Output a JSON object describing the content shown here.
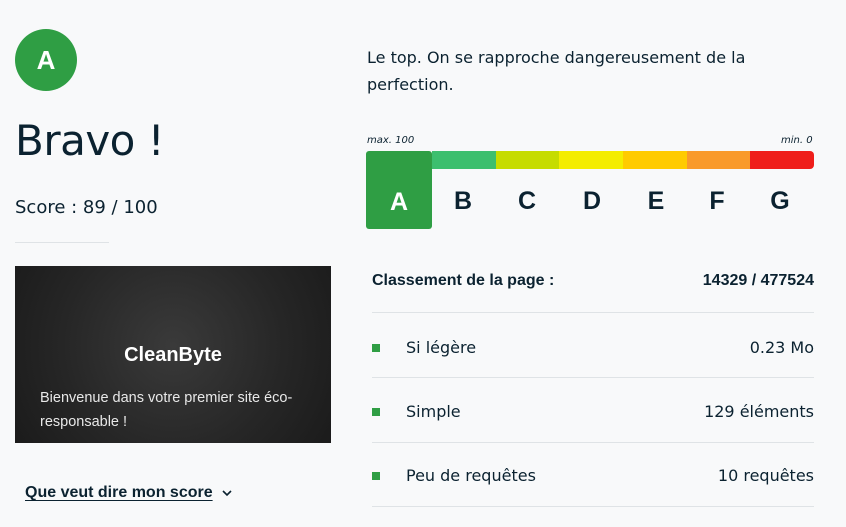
{
  "grade": {
    "letter": "A",
    "color": "#2f9e44"
  },
  "title": "Bravo !",
  "score_text": "Score : 89 / 100",
  "preview": {
    "site_title": "CleanByte",
    "site_text": "Bienvenue dans votre premier site éco-responsable !"
  },
  "more_link": "Que veut dire mon score",
  "description": "Le top. On se rapproche dangereusement de la perfection.",
  "scale": {
    "max_label": "max. 100",
    "min_label": "min. 0",
    "grades": [
      "A",
      "B",
      "C",
      "D",
      "E",
      "F",
      "G"
    ],
    "colors": [
      "#2f9e44",
      "#3cbf6e",
      "#c6dc00",
      "#f4ed00",
      "#ffcb00",
      "#f99a2b",
      "#ef1e1a"
    ]
  },
  "ranking": {
    "label": "Classement de la page :",
    "value": "14329 / 477524"
  },
  "metrics": [
    {
      "label": "Si légère",
      "value": "0.23 Mo"
    },
    {
      "label": "Simple",
      "value": "129 éléments"
    },
    {
      "label": "Peu de requêtes",
      "value": "10 requêtes"
    }
  ]
}
